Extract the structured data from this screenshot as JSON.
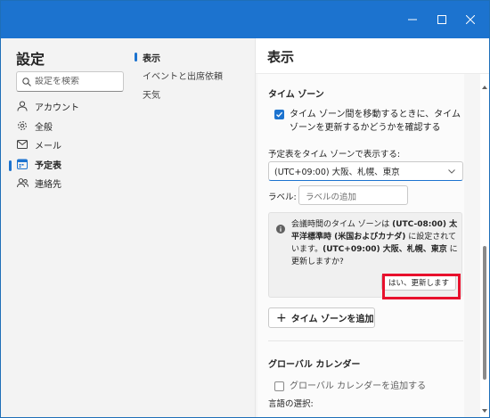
{
  "window": {
    "minimize_icon": "minimize-icon",
    "maximize_icon": "maximize-icon",
    "close_icon": "close-icon"
  },
  "sidebar": {
    "title": "設定",
    "search_placeholder": "設定を検索",
    "items": [
      {
        "label": "アカウント",
        "icon": "person-icon"
      },
      {
        "label": "全般",
        "icon": "gear-icon"
      },
      {
        "label": "メール",
        "icon": "mail-icon"
      },
      {
        "label": "予定表",
        "icon": "calendar-icon",
        "selected": true
      },
      {
        "label": "連絡先",
        "icon": "people-icon"
      }
    ]
  },
  "subnav": {
    "items": [
      {
        "label": "表示",
        "selected": true
      },
      {
        "label": "イベントと出席依頼"
      },
      {
        "label": "天気"
      }
    ]
  },
  "main": {
    "title": "表示",
    "timezone": {
      "heading": "タイム ゾーン",
      "confirm_checkbox_line1": "タイム ゾーン間を移動するときに、タイム",
      "confirm_checkbox_line2": "ゾーンを更新するかどうかを確認する",
      "confirm_checked": true,
      "display_label": "予定表をタイム ゾーンで表示する:",
      "selected_zone": "(UTC+09:00) 大阪、札幌、東京",
      "label_label": "ラベル:",
      "label_placeholder": "ラベルの追加",
      "info": {
        "t1": "会議時間のタイム ゾーンは ",
        "b1": "(UTC-08:00) 太平洋標準時 (米国およびカナダ)",
        "t2": " に設定されています。",
        "b2": "(UTC+09:00) 大阪、札幌、東京",
        "t3": " に更新しますか?"
      },
      "yes_button": "はい、更新します",
      "add_button": "タイム ゾーンを追加"
    },
    "global_calendar": {
      "heading": "グローバル カレンダー",
      "add_checkbox": "グローバル カレンダーを追加する",
      "add_checked": false,
      "language_label": "言語の選択:"
    }
  },
  "colors": {
    "accent": "#1c73cf",
    "highlight": "#e8112d"
  }
}
